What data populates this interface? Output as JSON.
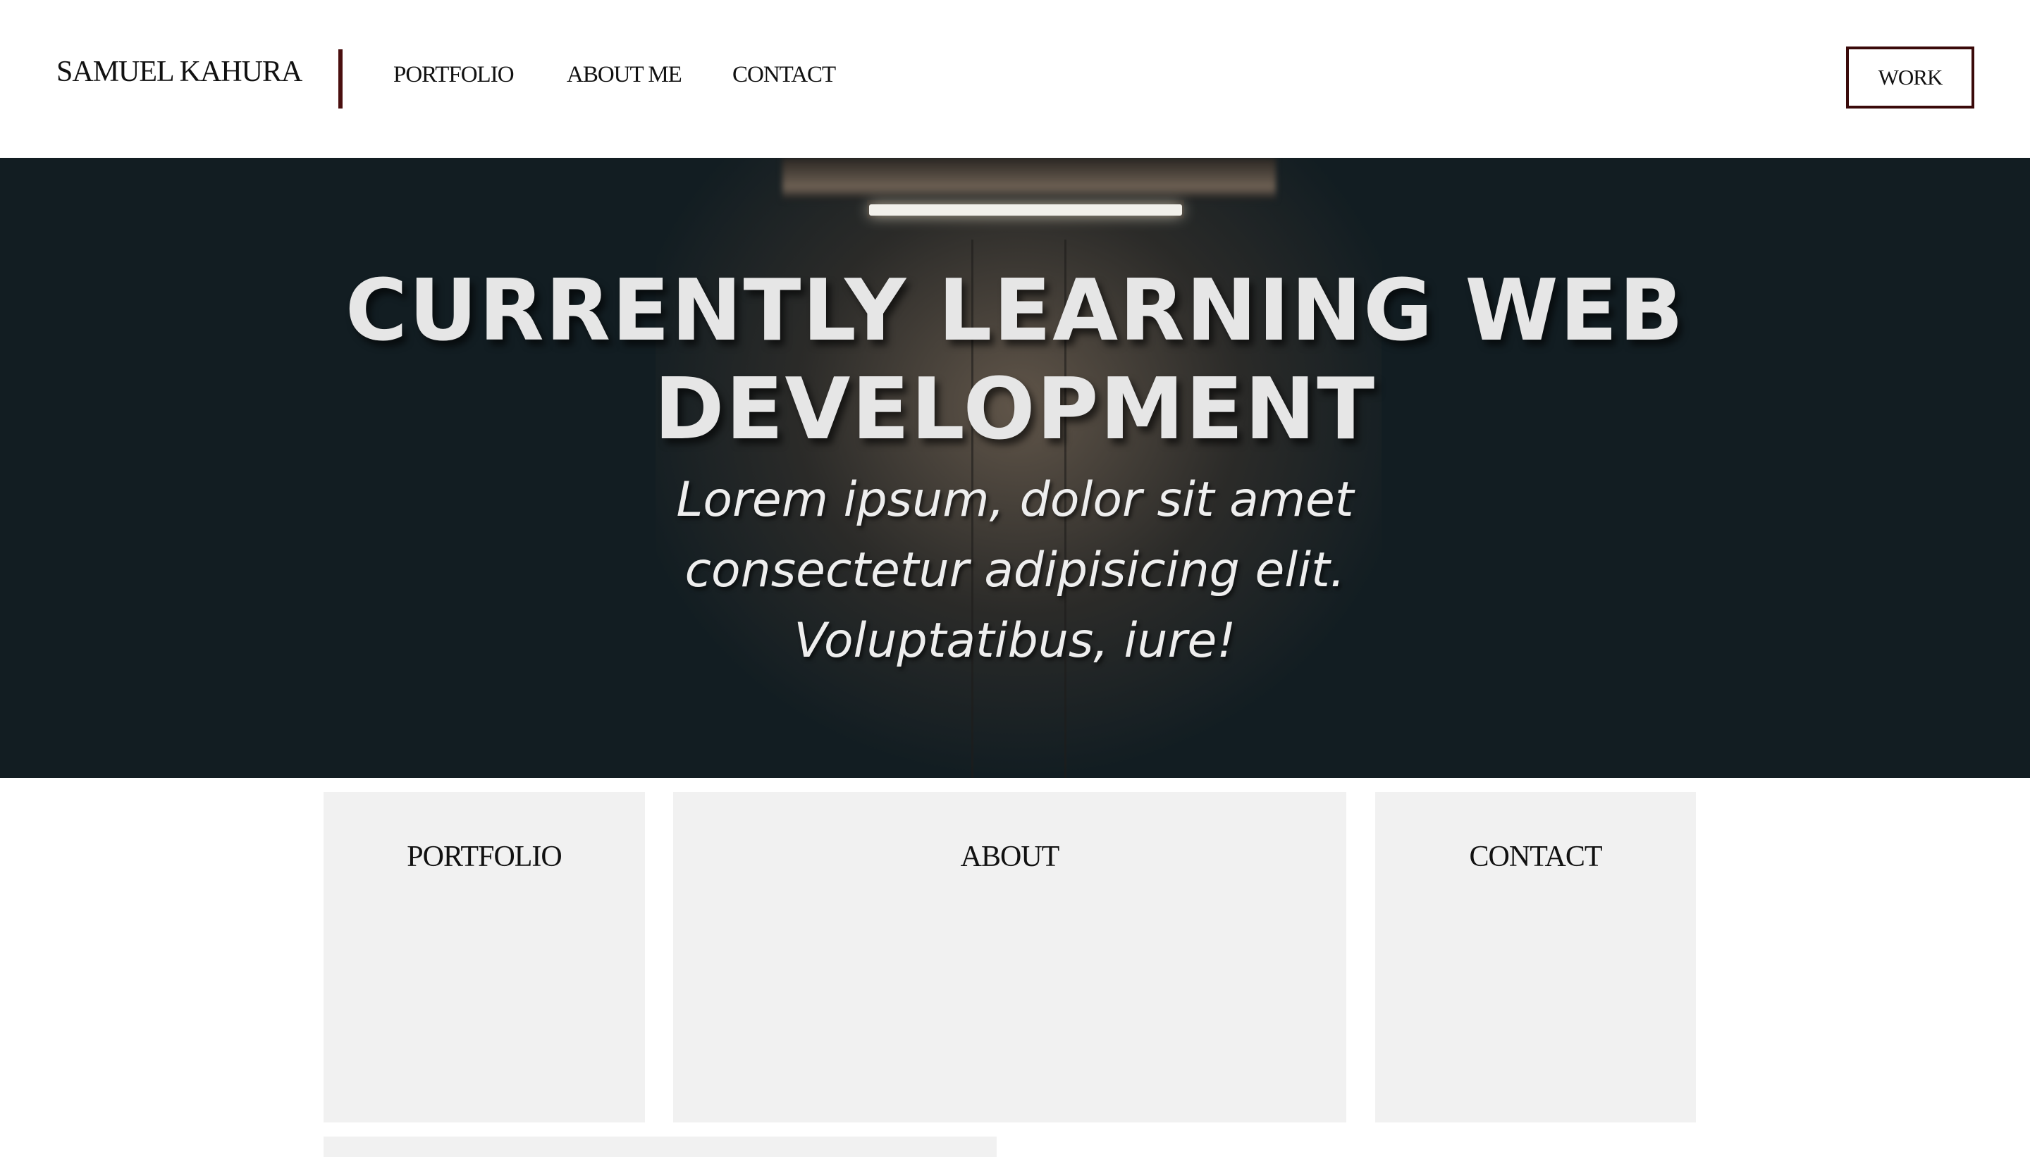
{
  "header": {
    "brand": "SAMUEL KAHURA",
    "nav": [
      "PORTFOLIO",
      "ABOUT ME",
      "CONTACT"
    ],
    "work_button": "WORK"
  },
  "hero": {
    "title_line1": "CURRENTLY LEARNING WEB",
    "title_line2": "DEVELOPMENT",
    "subtitle_lines": [
      "Lorem ipsum, dolor sit amet",
      "consectetur adipisicing elit.",
      "Voluptatibus, iure!"
    ]
  },
  "cards": [
    {
      "title": "PORTFOLIO"
    },
    {
      "title": "ABOUT"
    },
    {
      "title": "CONTACT"
    }
  ],
  "colors": {
    "accent": "#4a0f0f",
    "hero_bg": "#121d22",
    "card_bg": "#f1f1f1"
  }
}
